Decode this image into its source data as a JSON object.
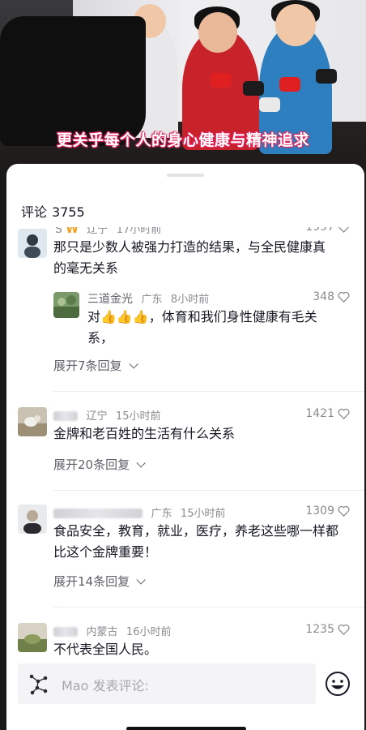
{
  "video": {
    "caption": "更关乎每个人的身心健康与精神追求"
  },
  "comments_panel": {
    "title": "评论",
    "count": "3755"
  },
  "comments": [
    {
      "user": "S",
      "location": "辽宁",
      "time": "17小时前",
      "likes": "1997",
      "text": "那只是少数人被强力打造的结果，与全民健康真的毫无关系",
      "reply": {
        "user": "三道金光",
        "location": "广东",
        "time": "8小时前",
        "likes": "348",
        "text": "对👍👍👍，体育和我们身性健康有毛关系，"
      },
      "expand": "展开7条回复"
    },
    {
      "user": "",
      "location": "辽宁",
      "time": "15小时前",
      "likes": "1421",
      "text": "金牌和老百姓的生活有什么关系",
      "expand": "展开20条回复"
    },
    {
      "user": "",
      "location": "广东",
      "time": "15小时前",
      "likes": "1309",
      "text": "食品安全，教育，就业，医疗，养老这些哪一样都比这个金牌重要！",
      "expand": "展开14条回复"
    },
    {
      "user": "",
      "location": "内蒙古",
      "time": "16小时前",
      "likes": "1235",
      "text": "不代表全国人民。"
    }
  ],
  "input": {
    "placeholder": "Mao 发表评论:"
  },
  "icons": {
    "heart": "heart-outline-icon",
    "emoji": "smiley-emoji-icon",
    "chevron": "chevron-down-icon"
  },
  "colors": {
    "caption_outline": "#e0245e",
    "text_primary": "#161823",
    "text_secondary": "#8a8b91"
  }
}
